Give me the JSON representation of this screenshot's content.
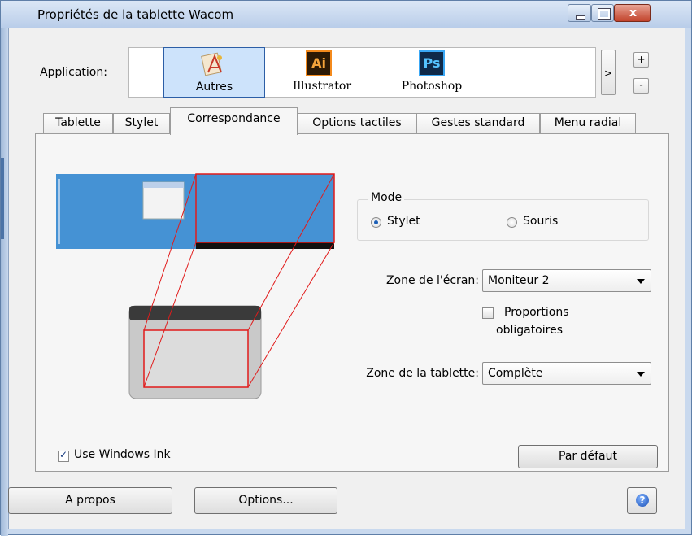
{
  "window": {
    "title": "Propriétés de la tablette Wacom",
    "min_icon": "minimize-icon",
    "max_icon": "maximize-icon",
    "close_glyph": "x"
  },
  "application": {
    "label": "Application:",
    "prev": "<",
    "next": ">",
    "add": "+",
    "remove": "-",
    "apps": [
      {
        "label": "Autres",
        "icon": "others-app-icon",
        "selected": true
      },
      {
        "label": "Illustrator",
        "icon": "illustrator-app-icon",
        "glyph": "Ai"
      },
      {
        "label": "Photoshop",
        "icon": "photoshop-app-icon",
        "glyph": "Ps"
      }
    ]
  },
  "tabs": [
    {
      "label": "Tablette"
    },
    {
      "label": "Stylet"
    },
    {
      "label": "Correspondance",
      "active": true
    },
    {
      "label": "Options tactiles"
    },
    {
      "label": "Gestes standard"
    },
    {
      "label": "Menu radial"
    }
  ],
  "mapping": {
    "mode": {
      "title": "Mode",
      "options": [
        {
          "label": "Stylet",
          "selected": true
        },
        {
          "label": "Souris",
          "selected": false
        }
      ]
    },
    "screen_area": {
      "label": "Zone de l'écran:",
      "value": "Moniteur 2"
    },
    "force_proportions": {
      "label_line1": "Proportions",
      "label_line2": "obligatoires",
      "checked": false
    },
    "tablet_area": {
      "label": "Zone de la tablette:",
      "value": "Complète"
    },
    "use_windows_ink": {
      "label": "Use Windows Ink",
      "checked": true
    },
    "default_button": "Par défaut"
  },
  "footer": {
    "about_button": "A propos",
    "options_button": "Options...",
    "help_icon": "help-icon",
    "help_glyph": "?"
  },
  "colors": {
    "monitor_blue": "#4592d4",
    "mapping_red": "#e11b1b",
    "selected_tile": "#cde3fb"
  }
}
